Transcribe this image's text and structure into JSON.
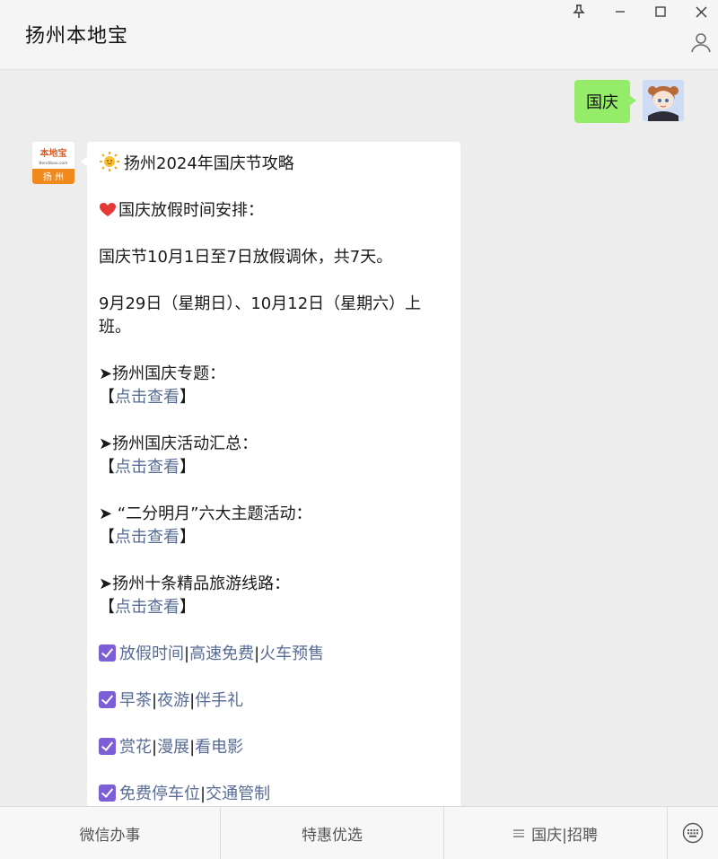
{
  "window": {
    "title": "扬州本地宝",
    "controls": [
      "pin-icon",
      "minimize-icon",
      "maximize-icon",
      "close-icon"
    ],
    "profile_icon": "user-icon"
  },
  "chat": {
    "user_message": "国庆",
    "bot_avatar": {
      "brand_text": "本地宝",
      "sub_text": "Bendibao.com",
      "city_text": "扬 州"
    },
    "bot_message": {
      "title": "扬州2024年国庆节攻略",
      "holiday_heading": "国庆放假时间安排：",
      "holiday_text": "国庆节10月1日至7日放假调休，共7天。",
      "workday_text": "9月29日（星期日）、10月12日（星期六）上班。",
      "sections": [
        {
          "label": "➤扬州国庆专题：",
          "bracket_open": "【",
          "link": "点击查看",
          "bracket_close": "】"
        },
        {
          "label": "➤扬州国庆活动汇总：",
          "bracket_open": "【",
          "link": "点击查看",
          "bracket_close": "】"
        },
        {
          "label": "➤ “二分明月”六大主题活动：",
          "bracket_open": "【",
          "link": "点击查看",
          "bracket_close": "】"
        },
        {
          "label": "➤扬州十条精品旅游线路：",
          "bracket_open": "【",
          "link": "点击查看",
          "bracket_close": "】"
        }
      ],
      "link_rows": [
        {
          "links": [
            "放假时间",
            "高速免费",
            "火车预售"
          ]
        },
        {
          "links": [
            "早茶",
            "夜游",
            "伴手礼"
          ]
        },
        {
          "links": [
            "赏花",
            "漫展",
            "看电影"
          ]
        },
        {
          "links": [
            "免费停车位",
            "交通管制"
          ]
        }
      ],
      "separator": "|"
    }
  },
  "menu": {
    "items": [
      "微信办事",
      "特惠优选",
      "国庆|招聘"
    ],
    "keyboard_icon": "keyboard-icon"
  },
  "colors": {
    "link": "#576b95",
    "user_bubble": "#95ec69",
    "check": "#7c5fd6",
    "background": "#ededed"
  }
}
